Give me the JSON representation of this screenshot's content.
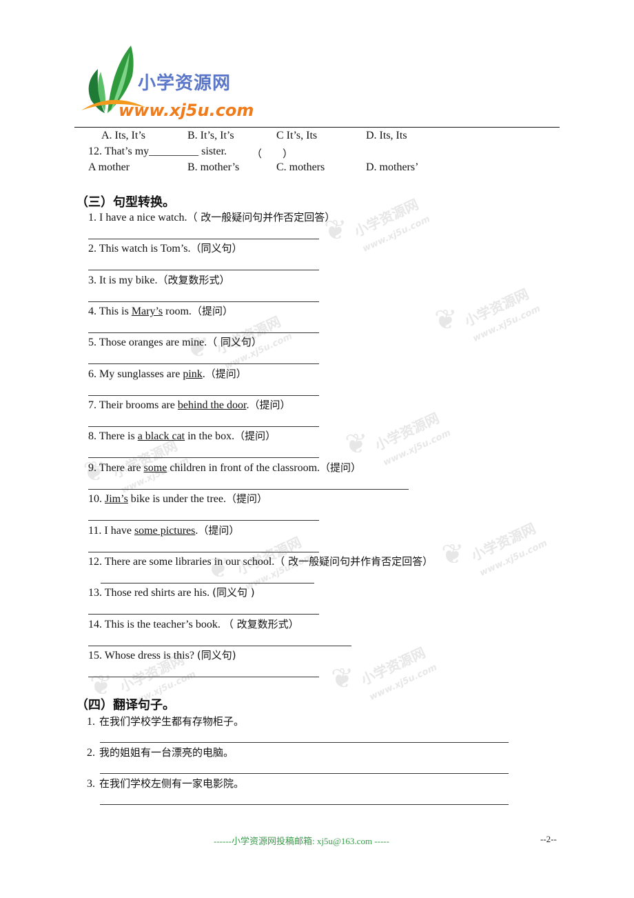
{
  "logo": {
    "name_cn": "小学资源网",
    "url": "www.xj5u.com",
    "colors": {
      "leaf": "#2e9a3c",
      "arc": "#f39a1e",
      "name": "#5a76c8",
      "url": "#f07b1a"
    }
  },
  "section2_tail": {
    "q11_options": [
      "A. Its, It’s",
      "B. It’s, It’s",
      "C It’s, Its",
      "D. Its, Its"
    ],
    "q12": {
      "prompt": "12. That’s my_________ sister.",
      "paren": "（　　）",
      "options": [
        "A mother",
        "B. mother’s",
        "C. mothers",
        "D. mothers’"
      ]
    }
  },
  "section3": {
    "heading": "（三）句型转换。",
    "items": [
      {
        "pre": "1. I have a nice watch.",
        "u": "",
        "post": "",
        "note": "（ 改一般疑问句并作否定回答）"
      },
      {
        "pre": "2. This watch is Tom’s.",
        "u": "",
        "post": "",
        "note": "（同义句）"
      },
      {
        "pre": "3. It is my bike.",
        "u": "",
        "post": "",
        "note": "（改复数形式）"
      },
      {
        "pre": "4. This is ",
        "u": "Mary’s",
        "post": " room.",
        "note": "（提问）"
      },
      {
        "pre": "5. Those oranges are mine.",
        "u": "",
        "post": "",
        "note": "（ 同义句）"
      },
      {
        "pre": "6. My sunglasses are ",
        "u": "pink",
        "post": ".",
        "note": "（提问）"
      },
      {
        "pre": "7. Their brooms are ",
        "u": "behind the door",
        "post": ".",
        "note": "（提问）"
      },
      {
        "pre": "8. There is ",
        "u": "a black cat",
        "post": " in the box.",
        "note": "（提问）"
      },
      {
        "pre": "9. There are ",
        "u": "some",
        "post": " children in front of the classroom.",
        "note": "（提问）"
      },
      {
        "pre": "10. ",
        "u": "Jim’s",
        "post": " bike is under the tree.",
        "note": "（提问）"
      },
      {
        "pre": "11. I have ",
        "u": "some pictures",
        "post": ".",
        "note": "（提问）"
      },
      {
        "pre": "12. There are some libraries in our school.",
        "u": "",
        "post": "",
        "note": "（ 改一般疑问句并作肯否定回答）"
      },
      {
        "pre": "13. Those red shirts are his. ",
        "u": "",
        "post": "",
        "note": "(同义句 )"
      },
      {
        "pre": "14. This is the teacher’s book. ",
        "u": "",
        "post": "",
        "note": "（ 改复数形式）"
      },
      {
        "pre": "15. Whose dress is this? ",
        "u": "",
        "post": "",
        "note": "(同义句)"
      }
    ]
  },
  "section4": {
    "heading": "（四）翻译句子。",
    "items": [
      {
        "num": "1.",
        "text": "在我们学校学生都有存物柜子。"
      },
      {
        "num": "2.",
        "text": "我的姐姐有一台漂亮的电脑。"
      },
      {
        "num": "3.",
        "text": "在我们学校左侧有一家电影院。"
      }
    ]
  },
  "footer": {
    "text": "------小学资源网投稿邮箱: xj5u@163.com -----",
    "page": "--2--"
  },
  "watermark": {
    "name_cn": "小学资源网",
    "url": "www.xj5u.com"
  }
}
